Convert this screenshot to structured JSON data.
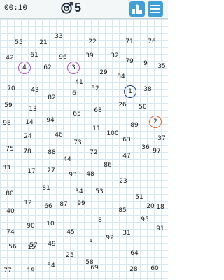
{
  "header": {
    "timer": "00:10",
    "target_number": "5",
    "target_icon": "target-arrow-icon",
    "leaderboard_icon": "podium-icon",
    "menu_icon": "hamburger-menu-icon",
    "accent_color": "#3ea0d6"
  },
  "board": {
    "circled": [
      {
        "value": "1",
        "color": "#2a3f8f"
      },
      {
        "value": "2",
        "color": "#e46a2f"
      },
      {
        "value": "3",
        "color": "#c04fc6"
      },
      {
        "value": "4",
        "color": "#c04fc6"
      }
    ],
    "numbers": [
      "55",
      "21",
      "33",
      "22",
      "71",
      "76",
      "42",
      "61",
      "96",
      "39",
      "32",
      "79",
      "9",
      "35",
      "62",
      "29",
      "84",
      "70",
      "43",
      "41",
      "6",
      "52",
      "38",
      "82",
      "26",
      "59",
      "13",
      "50",
      "65",
      "68",
      "98",
      "14",
      "94",
      "89",
      "100",
      "24",
      "46",
      "11",
      "63",
      "37",
      "75",
      "78",
      "88",
      "73",
      "36",
      "97",
      "72",
      "47",
      "44",
      "83",
      "17",
      "27",
      "93",
      "48",
      "86",
      "23",
      "80",
      "81",
      "34",
      "53",
      "12",
      "51",
      "20",
      "40",
      "66",
      "87",
      "99",
      "85",
      "18",
      "90",
      "10",
      "8",
      "95",
      "74",
      "45",
      "31",
      "57",
      "49",
      "3",
      "92",
      "91",
      "56",
      "15",
      "25",
      "58",
      "64",
      "19",
      "54",
      "69",
      "28",
      "77",
      "60",
      "67"
    ]
  }
}
